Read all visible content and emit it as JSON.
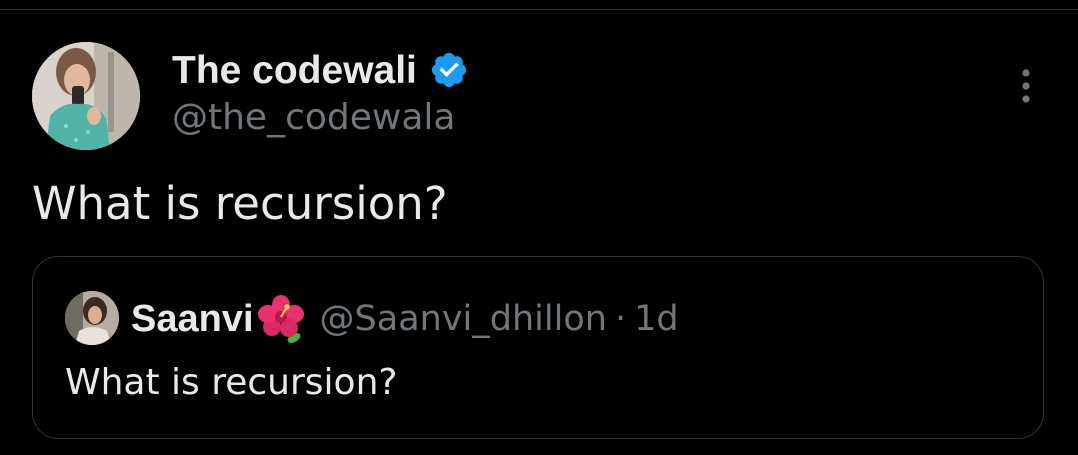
{
  "tweet": {
    "author_name": "The codewali",
    "author_handle": "@the_codewala",
    "verified": true,
    "text": "What is recursion?",
    "more_icon": "more-vertical-icon"
  },
  "quote": {
    "author_name": "Saanvi",
    "emoji": "hibiscus-icon",
    "author_handle": "@Saanvi_dhillon",
    "separator": "·",
    "time": "1d",
    "text": "What is recursion?"
  },
  "colors": {
    "background": "#000000",
    "primary_text": "#e7e9ea",
    "secondary_text": "#71767b",
    "border": "#2f3336",
    "verified_blue": "#1d9bf0"
  }
}
